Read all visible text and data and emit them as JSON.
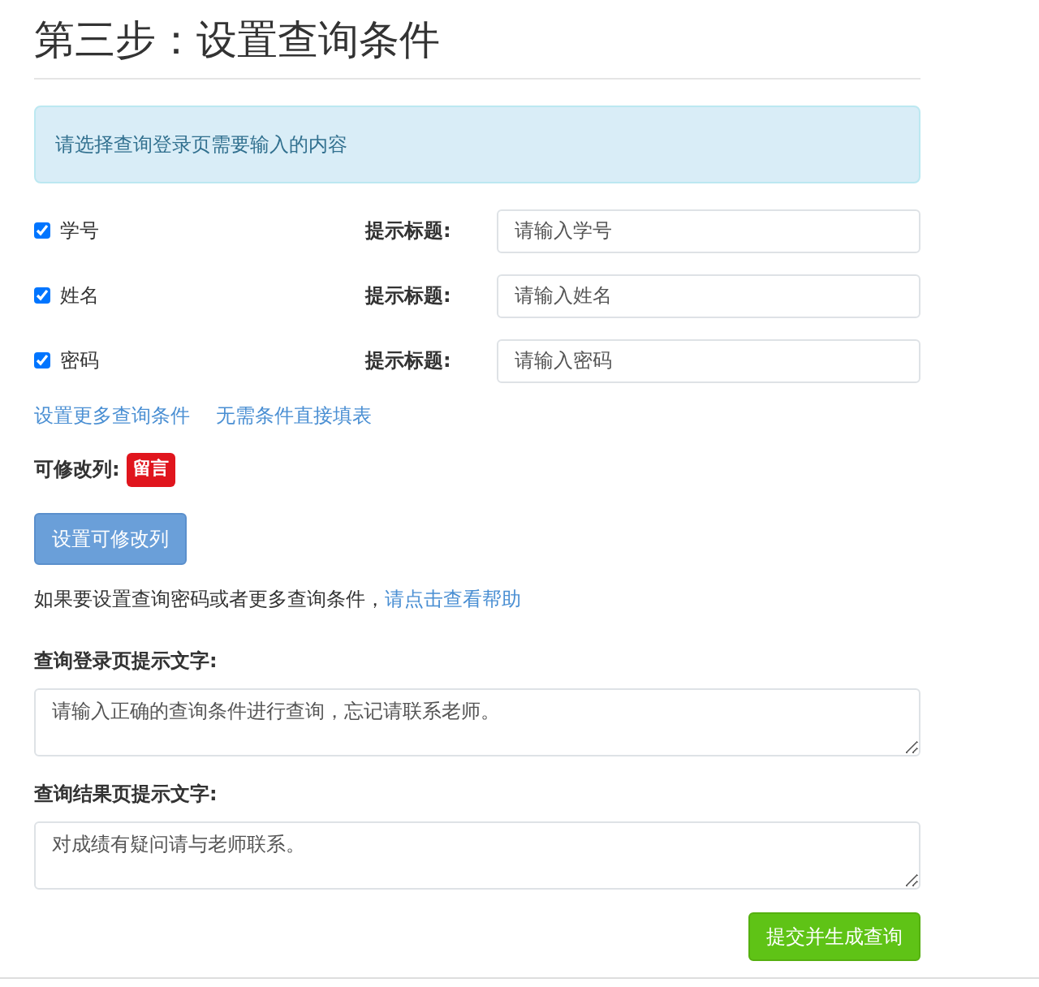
{
  "title": "第三步：设置查询条件",
  "alert": "请选择查询登录页需要输入的内容",
  "conditions": [
    {
      "label": "学号",
      "checked": true,
      "hint_label": "提示标题:",
      "value": "请输入学号"
    },
    {
      "label": "姓名",
      "checked": true,
      "hint_label": "提示标题:",
      "value": "请输入姓名"
    },
    {
      "label": "密码",
      "checked": true,
      "hint_label": "提示标题:",
      "value": "请输入密码"
    }
  ],
  "links": [
    "设置更多查询条件",
    "无需条件直接填表"
  ],
  "editable": {
    "label": "可修改列:",
    "tags": [
      "留言"
    ]
  },
  "set_button": "设置可修改列",
  "help": {
    "text": "如果要设置查询密码或者更多查询条件，",
    "link": "请点击查看帮助"
  },
  "login_tip": {
    "label": "查询登录页提示文字:",
    "value": "请输入正确的查询条件进行查询，忘记请联系老师。"
  },
  "result_tip": {
    "label": "查询结果页提示文字:",
    "value": "对成绩有疑问请与老师联系。"
  },
  "submit_button": "提交并生成查询"
}
